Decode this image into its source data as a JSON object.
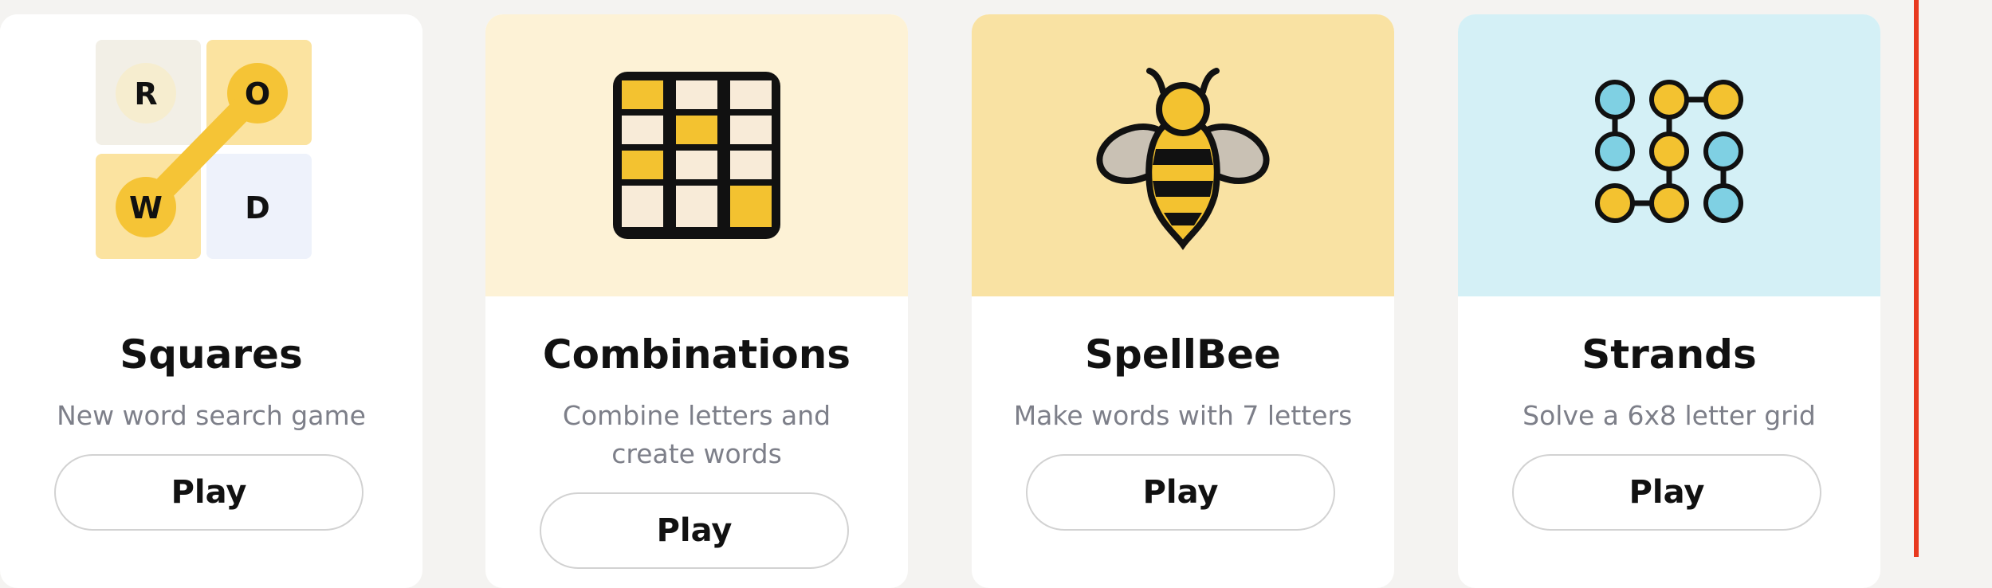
{
  "cards": [
    {
      "title": "Squares",
      "description": "New word search game",
      "play_label": "Play",
      "art_bg": "#ffffff",
      "tiles": [
        "R",
        "O",
        "W",
        "D"
      ]
    },
    {
      "title": "Combinations",
      "description": "Combine letters and create words",
      "play_label": "Play",
      "art_bg": "#fdf2d6"
    },
    {
      "title": "SpellBee",
      "description": "Make words with 7 letters",
      "play_label": "Play",
      "art_bg": "#f9e2a3"
    },
    {
      "title": "Strands",
      "description": "Solve a 6x8 letter grid",
      "play_label": "Play",
      "art_bg": "#d4f0f6"
    }
  ],
  "colors": {
    "accent_yellow": "#f3c230",
    "red_border": "#e8391f"
  }
}
